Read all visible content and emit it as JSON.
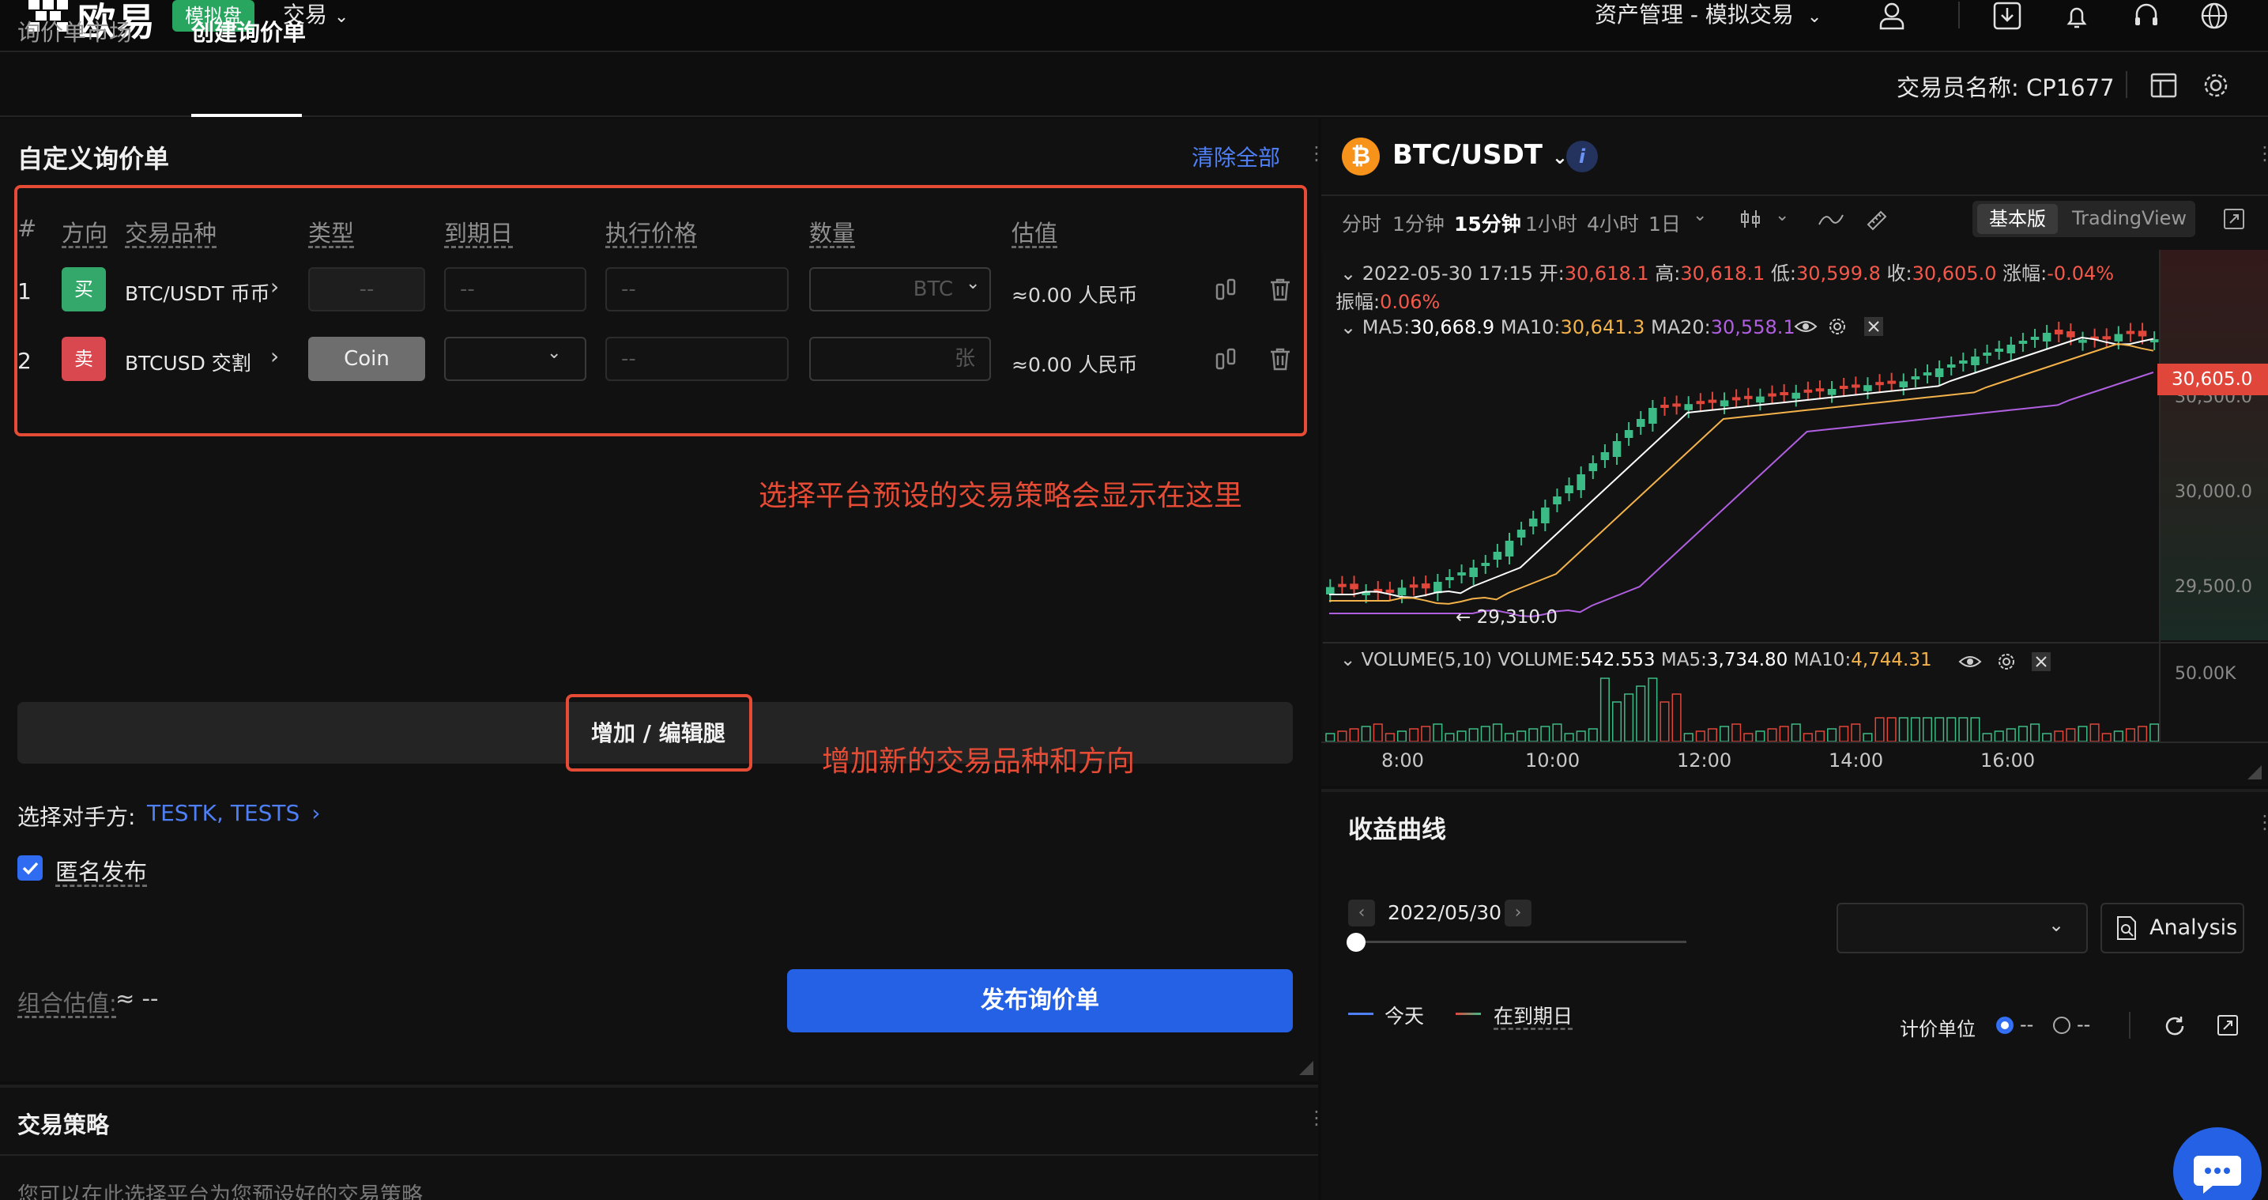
{
  "nav": {
    "brand": "欧易",
    "demo_badge": "模拟盘",
    "trade_menu": "交易",
    "asset_menu": "资产管理 - 模拟交易"
  },
  "tabs": {
    "market": "询价单市场",
    "create": "创建询价单"
  },
  "trader": {
    "label": "交易员名称: CP1677"
  },
  "rfq": {
    "title": "自定义询价单",
    "clear_all": "清除全部",
    "columns": [
      "#",
      "方向",
      "交易品种",
      "类型",
      "到期日",
      "执行价格",
      "数量",
      "估值"
    ],
    "rows": [
      {
        "index": "1",
        "side": "买",
        "side_color": "#34a86b",
        "instrument": "BTC/USDT 币币",
        "type": "--",
        "expiry": "--",
        "strike": "--",
        "qty_unit": "BTC",
        "valuation": "≈0.00 人民币"
      },
      {
        "index": "2",
        "side": "卖",
        "side_color": "#d9474f",
        "instrument": "BTCUSD 交割",
        "type": "Coin",
        "expiry": "",
        "strike": "--",
        "qty_unit": "张",
        "valuation": "≈0.00 人民币"
      }
    ],
    "annotation_strategy": "选择平台预设的交易策略会显示在这里",
    "add_edit_legs": "增加 / 编辑腿",
    "annotation_add": "增加新的交易品种和方向",
    "counterparty_label": "选择对手方:",
    "counterparty_value": "TESTK, TESTS",
    "anonymous_label": "匿名发布",
    "anonymous_checked": true,
    "combo_label": "组合估值:",
    "combo_value": "≈ --",
    "publish": "发布询价单"
  },
  "strategies": {
    "title": "交易策略",
    "hint": "您可以在此选择平台为您预设好的交易策略"
  },
  "chart_panel": {
    "pair": "BTC/USDT",
    "timeframes": [
      "分时",
      "1分钟",
      "15分钟",
      "1小时",
      "4小时",
      "1日"
    ],
    "active_timeframe": "15分钟",
    "view_basic": "基本版",
    "view_tradingview": "TradingView",
    "ohlc": {
      "datetime": "2022-05-30 17:15",
      "open_label": "开:",
      "open": "30,618.1",
      "high_label": "高:",
      "high": "30,618.1",
      "low_label": "低:",
      "low": "30,599.8",
      "close_label": "收:",
      "close": "30,605.0",
      "change_label": "涨幅:",
      "change": "-0.04%",
      "amplitude_label": "振幅:",
      "amplitude": "0.06%"
    },
    "ma": {
      "ma5_label": "MA5:",
      "ma5": "30,668.9",
      "ma10_label": "MA10:",
      "ma10": "30,641.3",
      "ma20_label": "MA20:",
      "ma20": "30,558.1"
    },
    "price_axis": [
      "30,500.0",
      "30,000.0",
      "29,500.0"
    ],
    "last_price": "30,605.0",
    "low_marker": "← 29,310.0",
    "volume": {
      "title": "VOLUME(5,10)",
      "volume_label": "VOLUME:",
      "volume": "542.553",
      "ma5_label": "MA5:",
      "ma5": "3,734.80",
      "ma10_label": "MA10:",
      "ma10": "4,744.31",
      "axis": "50.00K"
    },
    "time_axis": [
      "8:00",
      "10:00",
      "12:00",
      "14:00",
      "16:00"
    ],
    "colors": {
      "up": "#3dbb86",
      "down": "#e0463a",
      "ma5": "#ffffff",
      "ma10": "#f3b24a",
      "ma20": "#b05fe0"
    }
  },
  "profit_curve": {
    "title": "收益曲线",
    "date": "2022/05/30",
    "analysis": "Analysis",
    "legend_today": "今天",
    "legend_expiry": "在到期日",
    "unit_label": "计价单位",
    "unit_options": [
      "--",
      "--"
    ]
  }
}
